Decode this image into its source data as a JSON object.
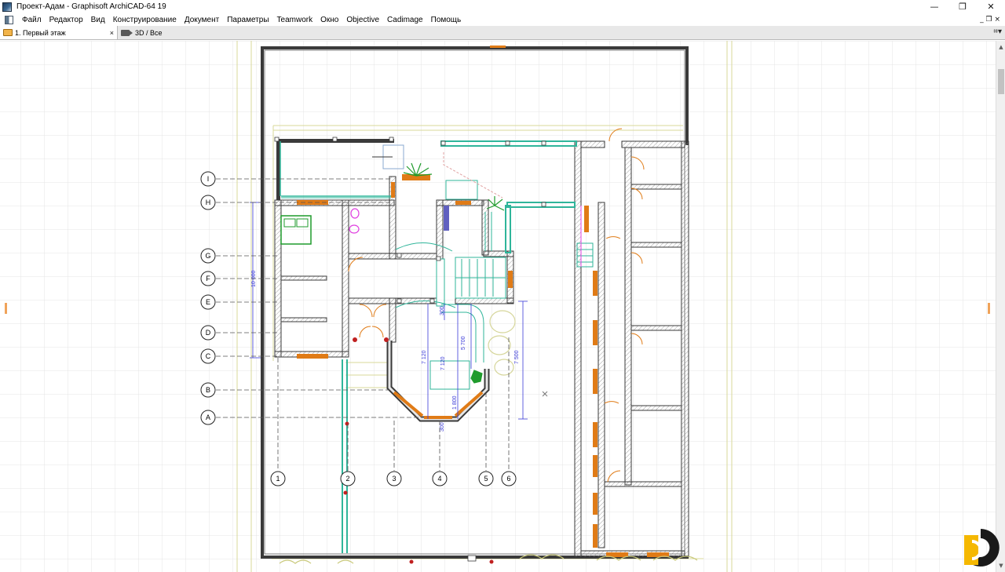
{
  "window": {
    "title": "Проект-Адам - Graphisoft ArchiCAD-64 19",
    "minimize_glyph": "—",
    "restore_glyph": "❐",
    "close_glyph": "✕"
  },
  "menu": {
    "items": [
      "Файл",
      "Редактор",
      "Вид",
      "Конструирование",
      "Документ",
      "Параметры",
      "Teamwork",
      "Окно",
      "Objective",
      "Cadimage",
      "Помощь"
    ],
    "doc_controls": "_ ❐ ×"
  },
  "tabs": [
    {
      "label": "1. Первый этаж",
      "icon": "folder-icon",
      "active": true,
      "close": "×"
    },
    {
      "label": "3D / Все",
      "icon": "camera-icon",
      "active": false
    }
  ],
  "tab_tools_glyph": "⌗▾",
  "drawing": {
    "grid_rows": [
      "I",
      "H",
      "G",
      "F",
      "E",
      "D",
      "C",
      "B",
      "A"
    ],
    "grid_cols": [
      "1",
      "2",
      "3",
      "4",
      "5",
      "6"
    ],
    "dimensions": {
      "d10000": "10 000",
      "d7120a": "7 120",
      "d7120b": "7 120",
      "d5700": "5 700",
      "d7500": "7 500",
      "d1800": "1 800",
      "d300a": "300",
      "d300b": "300"
    },
    "colors": {
      "wall": "#3a3a3a",
      "window": "#e07b16",
      "glazing": "#2fb59a",
      "dimension": "#3b3bd8",
      "trace": "#c9c97a",
      "plant": "#1f9b2c",
      "fixture": "#e040e0"
    }
  },
  "scrollbar": {
    "up_glyph": "▲",
    "down_glyph": "▼"
  }
}
